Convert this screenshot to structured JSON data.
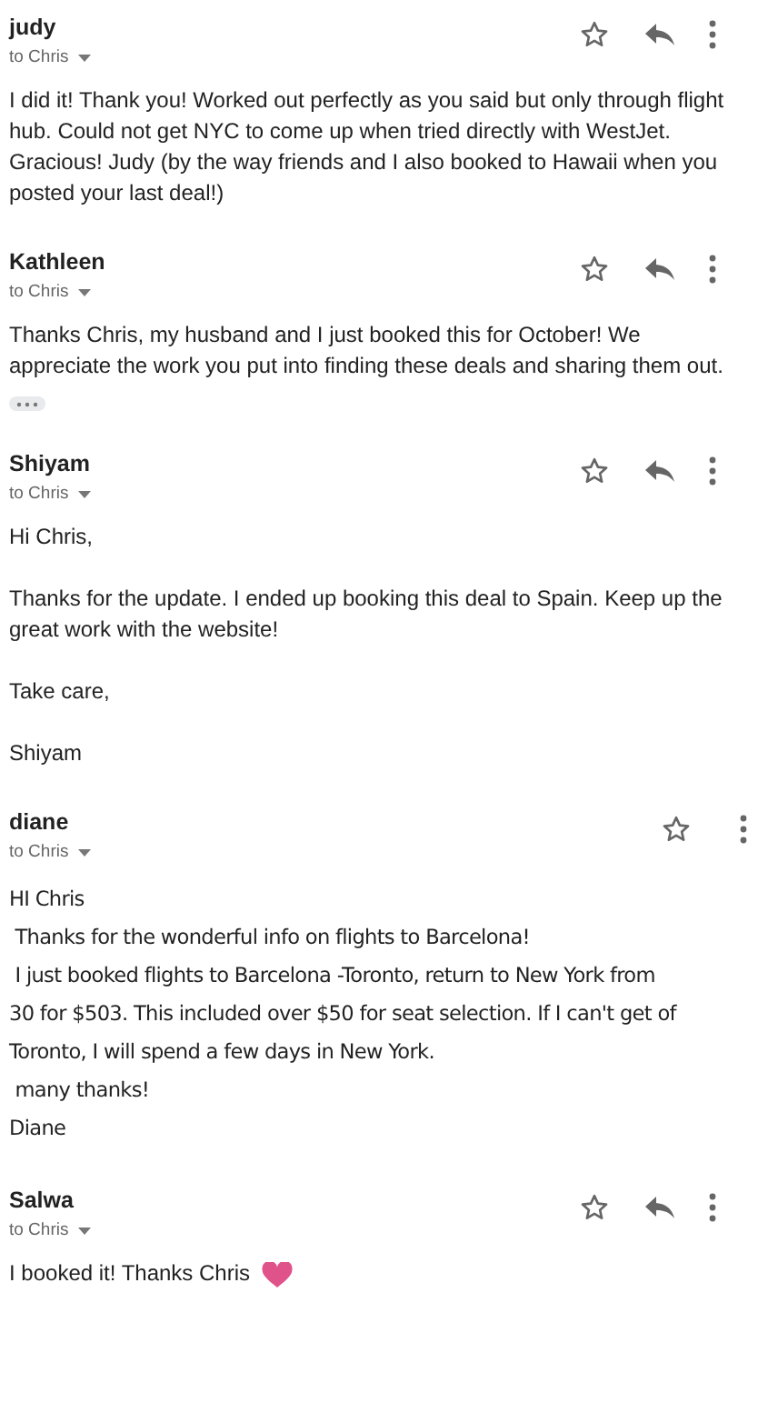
{
  "messages": [
    {
      "sender": "judy",
      "recipient": "to Chris",
      "star": true,
      "reply": true,
      "more": true,
      "kind": "plain",
      "paragraphs": [
        [
          "I did it! Thank you! Worked out perfectly as you said but only through flight hub. Could not get NYC to come up when tried directly with WestJet. Gracious! Judy (by the way friends and I also booked to Hawaii when you posted your last deal!)"
        ]
      ]
    },
    {
      "sender": "Kathleen",
      "recipient": "to Chris",
      "star": true,
      "reply": true,
      "more": true,
      "kind": "plain",
      "trimmed": true,
      "paragraphs": [
        [
          "Thanks Chris, my husband and I just booked this for October! We appreciate the work you put into finding these deals and sharing them out."
        ]
      ]
    },
    {
      "sender": "Shiyam",
      "recipient": "to Chris",
      "star": true,
      "reply": true,
      "more": true,
      "kind": "plain",
      "paragraphs": [
        [
          "Hi Chris,"
        ],
        [
          "Thanks for the update. I ended up booking this deal to Spain. Keep up the great work with the website!"
        ],
        [
          "Take care,"
        ],
        [
          "Shiyam"
        ]
      ]
    },
    {
      "sender": "diane",
      "recipient": "to Chris",
      "star": true,
      "reply": false,
      "more": true,
      "kind": "html",
      "paragraphs": [
        [
          "HI Chris",
          " Thanks for the wonderful info on flights to Barcelona!",
          " I just booked flights to Barcelona -Toronto, return to New York from",
          "30 for $503. This included over $50 for seat selection. If I can't get of",
          "Toronto, I will spend a few days in New York.",
          " many thanks!",
          "Diane"
        ]
      ]
    },
    {
      "sender": "Salwa",
      "recipient": "to Chris",
      "star": true,
      "reply": true,
      "more": true,
      "kind": "plain",
      "heart": true,
      "paragraphs": [
        [
          "I booked it! Thanks Chris"
        ]
      ]
    }
  ]
}
